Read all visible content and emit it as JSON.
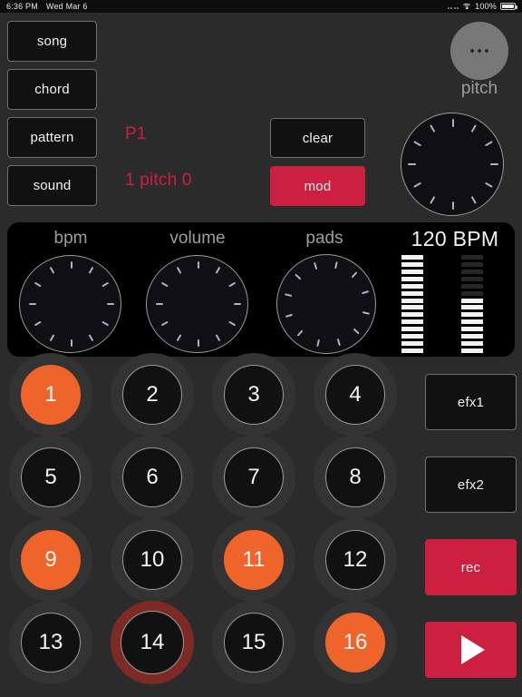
{
  "statusbar": {
    "time": "6:36 PM",
    "date": "Wed Mar 6",
    "battery_percent": "100%",
    "wifi_icon": "wifi-icon",
    "signal_icon": "signal-dots-icon",
    "battery_icon": "battery-full-icon"
  },
  "left_buttons": [
    {
      "label": "song"
    },
    {
      "label": "chord"
    },
    {
      "label": "pattern"
    },
    {
      "label": "sound"
    }
  ],
  "readouts": {
    "pattern_label": "P1",
    "sound_label": "1 pitch 0"
  },
  "top_right": {
    "menu_icon": "ellipsis-icon",
    "pitch_label": "pitch",
    "clear_label": "clear",
    "mod_label": "mod",
    "pitch_knob_name": "pitch-knob"
  },
  "panel": {
    "knobs": [
      {
        "label": "bpm"
      },
      {
        "label": "volume"
      },
      {
        "label": "pads"
      }
    ],
    "bpm_value": "120 BPM",
    "meter_left": {
      "total": 14,
      "lit": 14
    },
    "meter_right": {
      "total": 14,
      "lit": 8
    }
  },
  "pads": [
    {
      "label": "1",
      "state": "on"
    },
    {
      "label": "2",
      "state": "off"
    },
    {
      "label": "3",
      "state": "off"
    },
    {
      "label": "4",
      "state": "off"
    },
    {
      "label": "5",
      "state": "off"
    },
    {
      "label": "6",
      "state": "off"
    },
    {
      "label": "7",
      "state": "off"
    },
    {
      "label": "8",
      "state": "off"
    },
    {
      "label": "9",
      "state": "on"
    },
    {
      "label": "10",
      "state": "off"
    },
    {
      "label": "11",
      "state": "on"
    },
    {
      "label": "12",
      "state": "off"
    },
    {
      "label": "13",
      "state": "off"
    },
    {
      "label": "14",
      "state": "ring"
    },
    {
      "label": "15",
      "state": "off"
    },
    {
      "label": "16",
      "state": "on"
    }
  ],
  "side_buttons": {
    "efx1_label": "efx1",
    "efx2_label": "efx2",
    "rec_label": "rec",
    "play_icon": "play-triangle-icon"
  },
  "colors": {
    "background": "#2b2b2b",
    "panel": "#000000",
    "accent_orange": "#ef642b",
    "accent_red": "#cd2040",
    "pad_ring_red": "#7d2a24",
    "knob_tick": "#aab2cc",
    "text": "#f2f2f2",
    "muted_text": "#9d9d9d"
  }
}
